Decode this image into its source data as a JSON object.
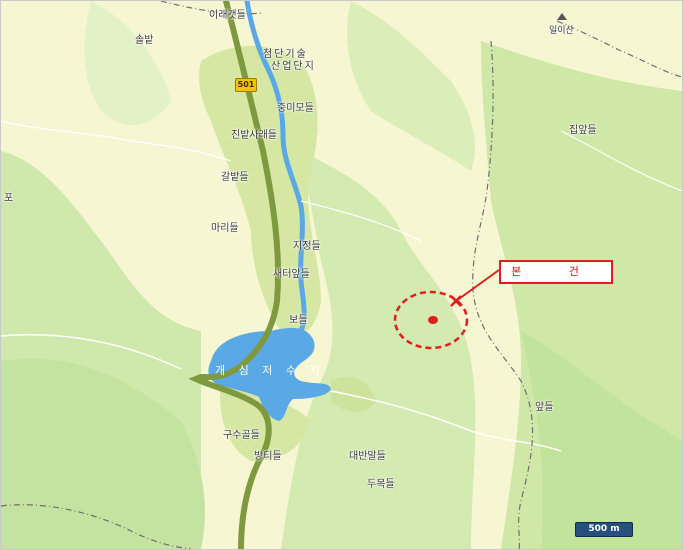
{
  "map": {
    "route_number": "501",
    "lake_label": "개 심 저 수 지",
    "site_label": "본   건",
    "scale_label": "500 m",
    "colors": {
      "background": "#f6f7d2",
      "forest": "#c7e6a6",
      "urban": "#d7e8a6",
      "water": "#5aa8e6",
      "road": "#7f9a3e",
      "boundary": "#6f6f6f",
      "marker": "#e01e1e"
    },
    "places": [
      {
        "name": "이래갯들",
        "id": "iraegaet"
      },
      {
        "name": "솔밭",
        "id": "solbat"
      },
      {
        "name": "첨단기술",
        "id": "cheomdan"
      },
      {
        "name": "산업단지",
        "id": "saneop"
      },
      {
        "name": "일이산",
        "id": "ilisan"
      },
      {
        "name": "중미모들",
        "id": "jungmimo"
      },
      {
        "name": "진밭사래들",
        "id": "jinbat"
      },
      {
        "name": "갈밭들",
        "id": "galbat"
      },
      {
        "name": "집앞들",
        "id": "jibap"
      },
      {
        "name": "포",
        "id": "po"
      },
      {
        "name": "마리들",
        "id": "mari"
      },
      {
        "name": "지정들",
        "id": "jijeong"
      },
      {
        "name": "새터앞들",
        "id": "saeteo"
      },
      {
        "name": "보들",
        "id": "bo"
      },
      {
        "name": "앞들",
        "id": "apdeul"
      },
      {
        "name": "구수골들",
        "id": "gusugol"
      },
      {
        "name": "방티들",
        "id": "bangti"
      },
      {
        "name": "대반말들",
        "id": "daeban"
      },
      {
        "name": "두목들",
        "id": "dumok"
      }
    ]
  }
}
